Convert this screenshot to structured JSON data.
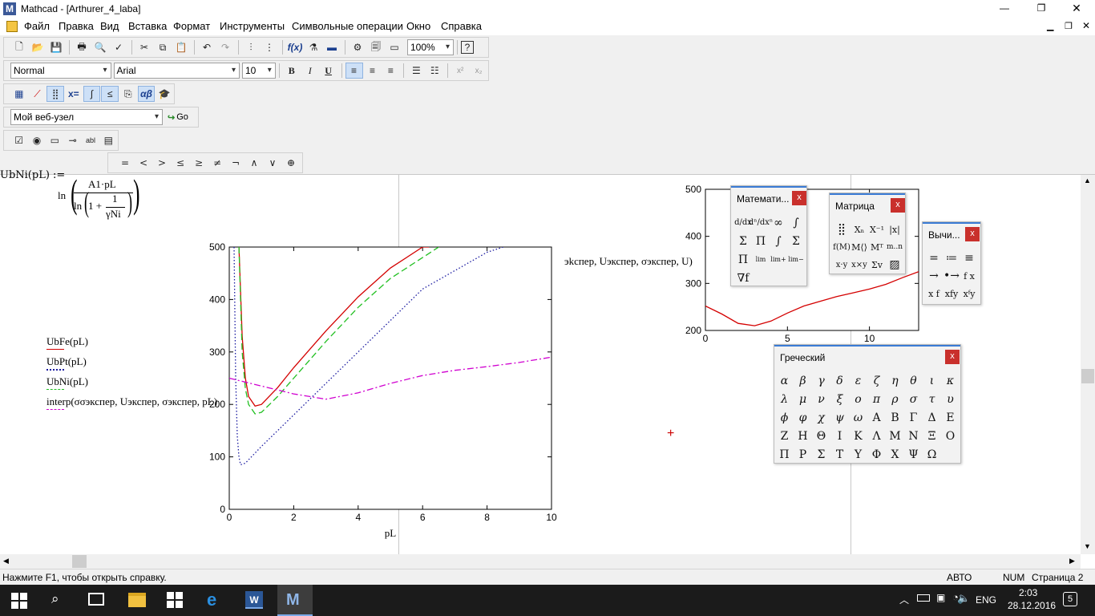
{
  "window": {
    "title": "Mathcad - [Arthurer_4_laba]"
  },
  "menu": [
    "Файл",
    "Правка",
    "Вид",
    "Вставка",
    "Формат",
    "Инструменты",
    "Символьные операции",
    "Окно",
    "Справка"
  ],
  "toolbar": {
    "zoom": "100%",
    "style": "Normal",
    "font": "Arial",
    "size": "10",
    "web": "Мой веб-узел",
    "go": "Go"
  },
  "boolean_bar": [
    "=",
    "<",
    ">",
    "≤",
    "≥",
    "≠",
    "¬",
    "∧",
    "∨",
    "⊕"
  ],
  "formula": {
    "lhs": "UbNi(pL) :=",
    "ln1": "ln",
    "num": "A1·pL",
    "ln2": "ln",
    "one_plus": "1 +",
    "frac_num": "1",
    "frac_den": "γNi"
  },
  "legend": [
    "UbFe(pL)",
    "UbPt(pL)",
    "UbNi(pL)",
    "interp(σσэкспер, Uэкспер, σэкспер, pL)"
  ],
  "side_text": "эkспер, Uэкспер, σэкспер, U)",
  "chart_data": [
    {
      "type": "line",
      "xlabel": "pL",
      "xlim": [
        0,
        10
      ],
      "ylim": [
        0,
        500
      ],
      "xticks": [
        "0",
        "2",
        "4",
        "6",
        "8",
        "10"
      ],
      "yticks": [
        "0",
        "100",
        "200",
        "300",
        "400",
        "500"
      ],
      "series": [
        {
          "name": "UbFe(pL)",
          "color": "#d40000",
          "style": "solid",
          "x": [
            0.3,
            0.4,
            0.5,
            0.6,
            0.8,
            1,
            1.5,
            2,
            3,
            4,
            5,
            6,
            6.2
          ],
          "y": [
            500,
            330,
            250,
            215,
            197,
            200,
            232,
            270,
            340,
            405,
            460,
            500,
            500
          ]
        },
        {
          "name": "UbPt(pL)",
          "color": "#1a1aa0",
          "style": "dotted",
          "x": [
            0.15,
            0.2,
            0.25,
            0.3,
            0.35,
            0.5,
            1,
            2,
            3,
            4,
            5,
            6,
            7,
            8,
            8.5
          ],
          "y": [
            500,
            250,
            140,
            100,
            85,
            88,
            120,
            180,
            240,
            300,
            360,
            420,
            455,
            490,
            500
          ]
        },
        {
          "name": "UbNi(pL)",
          "color": "#22c022",
          "style": "dashed",
          "x": [
            0.3,
            0.4,
            0.5,
            0.6,
            0.8,
            1,
            1.5,
            2,
            3,
            4,
            5,
            6,
            6.5
          ],
          "y": [
            500,
            300,
            230,
            200,
            182,
            185,
            215,
            250,
            320,
            385,
            440,
            480,
            500
          ]
        },
        {
          "name": "interp(σσэкспер, Uэкспер, σэкспер, pL)",
          "color": "#d000d0",
          "style": "dashdot",
          "x": [
            0,
            1,
            2,
            3,
            4,
            5,
            6,
            7,
            8,
            9,
            10
          ],
          "y": [
            250,
            235,
            220,
            210,
            222,
            240,
            255,
            265,
            272,
            280,
            290
          ]
        }
      ]
    },
    {
      "type": "line",
      "xlim": [
        0,
        13
      ],
      "ylim": [
        200,
        500
      ],
      "xticks": [
        "0",
        "5",
        "10"
      ],
      "yticks": [
        "200",
        "300",
        "400",
        "500"
      ],
      "series": [
        {
          "color": "#d40000",
          "x": [
            0,
            1,
            2,
            3,
            4,
            5,
            6,
            7,
            8,
            9,
            10,
            11,
            12,
            13
          ],
          "y": [
            252,
            235,
            215,
            210,
            220,
            237,
            252,
            262,
            272,
            280,
            288,
            298,
            312,
            325
          ]
        }
      ]
    }
  ],
  "panels": {
    "math": {
      "title": "Математи...",
      "close": "x"
    },
    "matrix": {
      "title": "Матрица",
      "close": "x"
    },
    "eval": {
      "title": "Вычи...",
      "close": "x"
    },
    "greek": {
      "title": "Греческий",
      "close": "x",
      "letters": [
        "α",
        "β",
        "γ",
        "δ",
        "ε",
        "ζ",
        "η",
        "θ",
        "ι",
        "κ",
        "λ",
        "μ",
        "ν",
        "ξ",
        "ο",
        "π",
        "ρ",
        "σ",
        "τ",
        "υ",
        "ϕ",
        "φ",
        "χ",
        "ψ",
        "ω",
        "Α",
        "Β",
        "Γ",
        "Δ",
        "Ε",
        "Ζ",
        "Η",
        "Θ",
        "Ι",
        "Κ",
        "Λ",
        "Μ",
        "Ν",
        "Ξ",
        "Ο",
        "Π",
        "Ρ",
        "Σ",
        "Τ",
        "Υ",
        "Φ",
        "Χ",
        "Ψ",
        "Ω"
      ]
    }
  },
  "status": {
    "help": "Нажмите F1, чтобы открыть справку.",
    "auto": "АВТО",
    "num": "NUM",
    "page": "Страница 2"
  },
  "taskbar": {
    "lang": "ENG",
    "time": "2:03",
    "date": "28.12.2016",
    "badge": "5"
  }
}
